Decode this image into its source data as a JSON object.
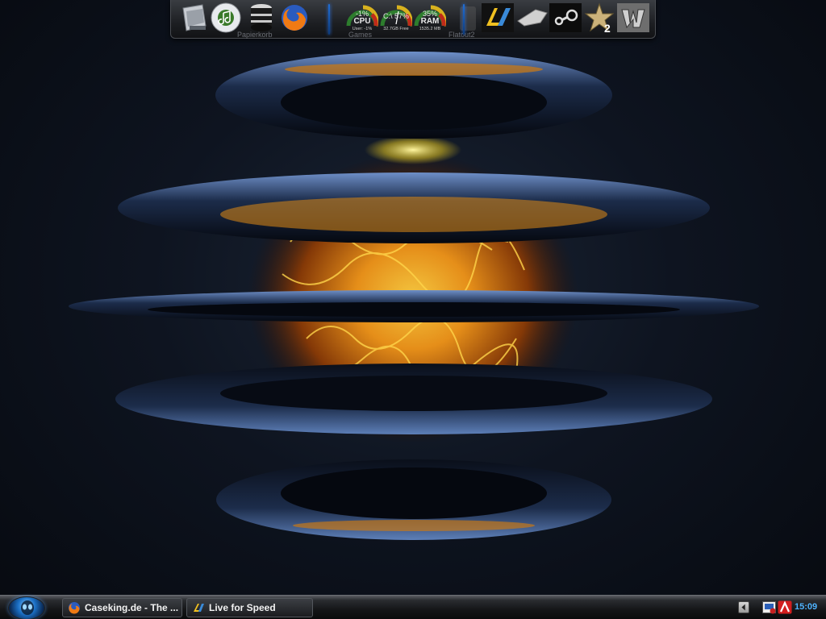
{
  "dock": {
    "items": [
      {
        "name": "recycle-bin",
        "caption": "Papierkorb"
      },
      {
        "name": "itunes"
      },
      {
        "name": "storage"
      },
      {
        "name": "firefox"
      }
    ],
    "gauges": [
      {
        "name": "cpu",
        "pct": "-1%",
        "label": "CPU",
        "sub": "User: -1%",
        "value": 0.01,
        "caption": "Games"
      },
      {
        "name": "disk",
        "pct": "C:\\ 57%",
        "label": "",
        "sub": "32.7GB Free",
        "value": 0.57
      },
      {
        "name": "ram",
        "pct": "35%",
        "label": "RAM",
        "sub": "1535.2 MB",
        "value": 0.35
      }
    ],
    "shortcuts": [
      {
        "name": "flatout2",
        "caption": "Flatout2"
      },
      {
        "name": "live-for-speed"
      },
      {
        "name": "racing-game"
      },
      {
        "name": "steam"
      },
      {
        "name": "gothic2"
      },
      {
        "name": "warcraft3"
      }
    ]
  },
  "taskbar": {
    "windows": [
      {
        "title": "Caseking.de - The ...",
        "icon": "firefox-icon"
      },
      {
        "title": "Live for Speed",
        "icon": "lfs-icon"
      }
    ],
    "tray": {
      "clock": "15:09"
    }
  },
  "colors": {
    "accent": "#4fb3ff",
    "fire": "#f0a020",
    "dock_sep": "#1f6fd6"
  }
}
